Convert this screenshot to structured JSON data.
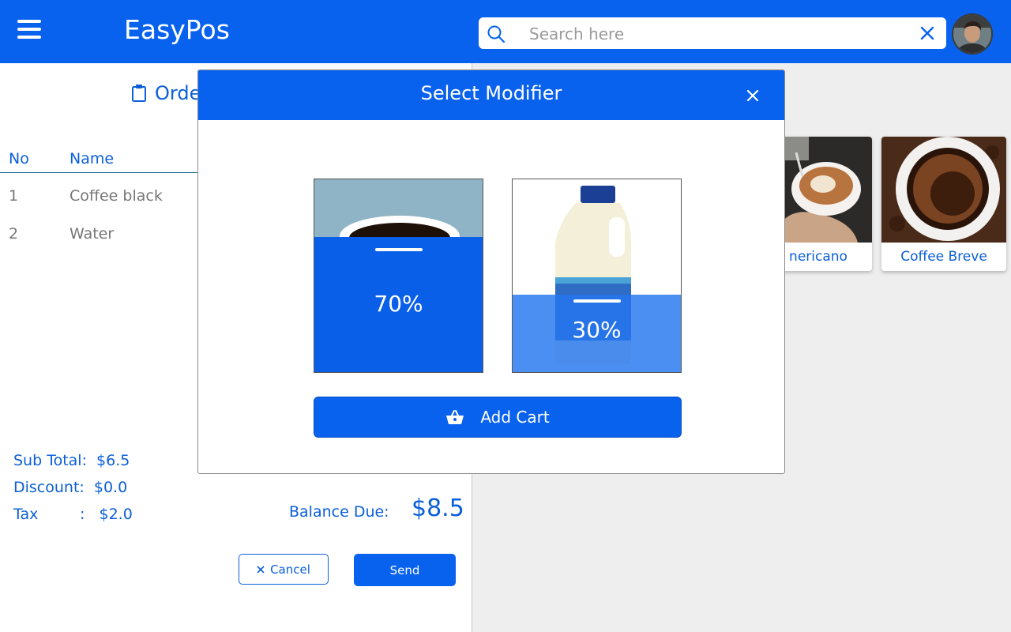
{
  "header": {
    "app_title": "EasyPos",
    "search_placeholder": "Search here",
    "search_value": ""
  },
  "order": {
    "heading": "Orde",
    "columns": {
      "no": "No",
      "name": "Name"
    },
    "items": [
      {
        "no": "1",
        "name": "Coffee black"
      },
      {
        "no": "2",
        "name": "Water"
      }
    ],
    "summary": {
      "subtotal_label": "Sub Total:",
      "subtotal_value": "$6.5",
      "discount_label": "Discount:",
      "discount_value": "$0.0",
      "tax_label": "Tax",
      "tax_sep": ":",
      "tax_value": "$2.0"
    },
    "balance_label": "Balance Due:",
    "balance_value": "$8.5",
    "cancel_label": "Cancel",
    "send_label": "Send"
  },
  "products": [
    {
      "label": "nericano"
    },
    {
      "label": "Coffee Breve"
    }
  ],
  "modal": {
    "title": "Select Modifier",
    "options": [
      {
        "name": "coffee",
        "percent_label": "70%",
        "fill": 0.7,
        "icon": "coffee-cup-image"
      },
      {
        "name": "milk",
        "percent_label": "30%",
        "fill": 0.4,
        "icon": "milk-jug-image"
      }
    ],
    "add_cart_label": "Add Cart"
  },
  "colors": {
    "primary": "#0862ee",
    "text_primary": "#0b5fd8",
    "panel_bg": "#eeeeee",
    "milk_fill": "#4d8ff5"
  }
}
